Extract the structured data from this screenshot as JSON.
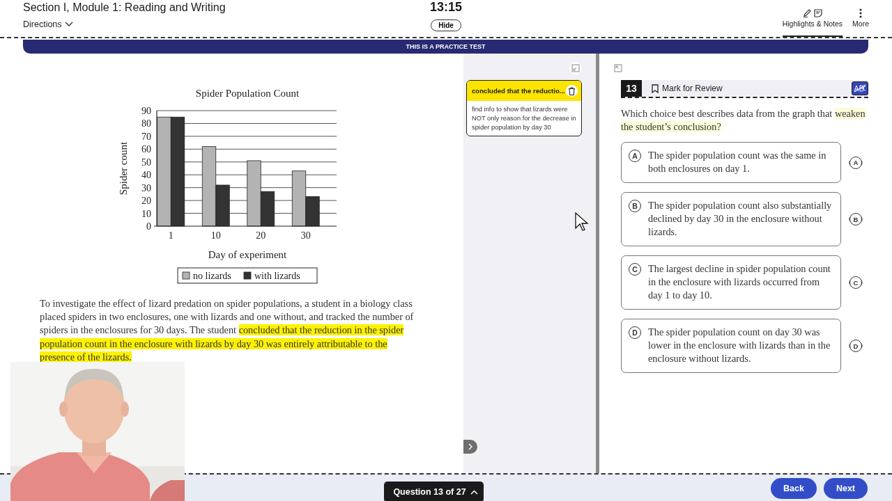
{
  "header": {
    "section_title": "Section I, Module 1: Reading and Writing",
    "directions": "Directions",
    "timer": "13:15",
    "hide_button": "Hide",
    "tools": [
      {
        "label": "Highlights & Notes",
        "kind": "highlights",
        "selected": true
      },
      {
        "label": "More",
        "kind": "more",
        "selected": false
      }
    ]
  },
  "banner": "THIS IS A PRACTICE TEST",
  "passage": {
    "chart_data": {
      "type": "bar",
      "title": "Spider Population Count",
      "xlabel": "Day of experiment",
      "ylabel": "Spider count",
      "categories": [
        "1",
        "10",
        "20",
        "30"
      ],
      "series": [
        {
          "name": "no lizards",
          "color": "#b3b3b3",
          "values": [
            85,
            62,
            51,
            43
          ]
        },
        {
          "name": "with lizards",
          "color": "#333333",
          "values": [
            85,
            32,
            27,
            23
          ]
        }
      ],
      "ylim": [
        0,
        90
      ],
      "yticks": [
        0,
        10,
        20,
        30,
        40,
        50,
        60,
        70,
        80,
        90
      ],
      "grid": true,
      "legend": true
    },
    "segments": [
      {
        "text": "To investigate the effect of lizard predation on spider populations, a student in a biology class placed spiders in two enclosures, one with lizards and one without, and tracked the number of spiders in the enclosures for 30 days. The student ",
        "highlighted": false
      },
      {
        "text": "concluded that the reduction in the spider population count in the enclosure with lizards by day 30 was entirely attributable to the presence of the lizards.",
        "highlighted": true
      }
    ]
  },
  "notes": [
    {
      "title": "concluded that the reductio...",
      "text": "find info to show that lizards were NOT only reason for the decrease in spider population by day 30"
    }
  ],
  "question": {
    "number": "13",
    "mark_for_review": "Mark for Review",
    "marked": false,
    "segments": [
      {
        "text": "Which choice best describes data from the graph that ",
        "highlighted": false
      },
      {
        "text": "weaken the student’s conclusion?",
        "highlighted": true
      }
    ],
    "options": [
      {
        "letter": "A",
        "text": "The spider population count was the same in both enclosures on day 1.",
        "selected": false,
        "crossout_letter": "A"
      },
      {
        "letter": "B",
        "text": "The spider population count also substantially declined by day 30 in the enclosure without lizards.",
        "selected": false,
        "crossout_letter": "B"
      },
      {
        "letter": "C",
        "text": "The largest decline in spider population count in the enclosure with lizards occurred from day 1 to day 10.",
        "selected": false,
        "crossout_letter": "C"
      },
      {
        "letter": "D",
        "text": "The spider population count on day 30 was lower in the enclosure with lizards than in the enclosure without lizards.",
        "selected": false,
        "crossout_letter": "D"
      }
    ]
  },
  "footer": {
    "question_nav": "Question 13 of 27",
    "back": "Back",
    "next": "Next"
  }
}
